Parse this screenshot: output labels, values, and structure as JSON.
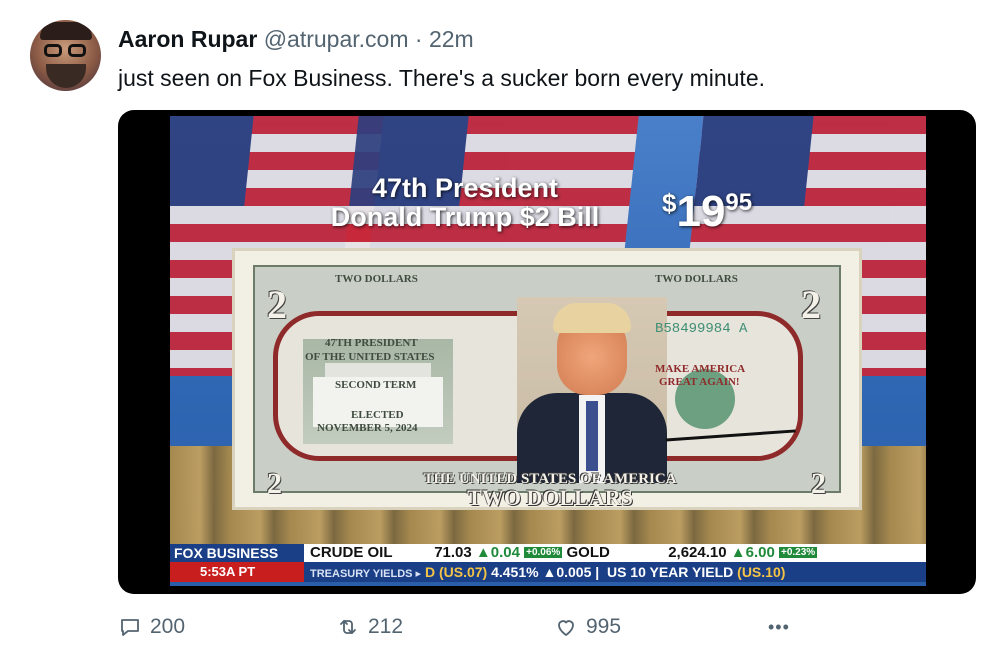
{
  "author": {
    "name": "Aaron Rupar",
    "handle": "@atrupar.com",
    "separator": " · ",
    "time": "22m"
  },
  "post_text": "just seen on Fox Business. There's a sucker born every minute.",
  "video_frame": {
    "promo_line1": "47th President",
    "promo_line2": "Donald Trump $2 Bill",
    "price_currency": "$",
    "price_main": "19",
    "price_cents": "95",
    "bill": {
      "corner_denom": "2",
      "top_left": "TWO DOLLARS",
      "top_right": "TWO DOLLARS",
      "serial": "B58499984 A",
      "left_text_1": "47TH PRESIDENT",
      "left_text_2": "OF THE UNITED STATES",
      "left_text_3": "SECOND TERM",
      "left_text_4": "ELECTED",
      "left_text_5": "NOVEMBER 5, 2024",
      "right_text_1": "MAKE AMERICA",
      "right_text_2": "GREAT AGAIN!",
      "bottom_line_1": "THE UNITED STATES OF AMERICA",
      "bottom_line_2": "TWO DOLLARS"
    },
    "ticker": {
      "network": "FOX BUSINESS",
      "time": "5:53A PT",
      "row1": {
        "label": "CRUDE OIL",
        "value": "71.03",
        "change": "▲0.04",
        "pct": "+0.06%",
        "label2": "GOLD",
        "value2": "2,624.10",
        "change2": "▲6.00",
        "pct2": "+0.23%"
      },
      "row2": {
        "label": "TREASURY YIELDS ▸",
        "code1": "D (US.07)",
        "val1": "4.451%",
        "chg1": "▲0.005",
        "label2": "US 10 YEAR YIELD",
        "code2": "(US.10)"
      }
    }
  },
  "actions": {
    "replies": "200",
    "reposts": "212",
    "likes": "995",
    "more": "•••"
  }
}
